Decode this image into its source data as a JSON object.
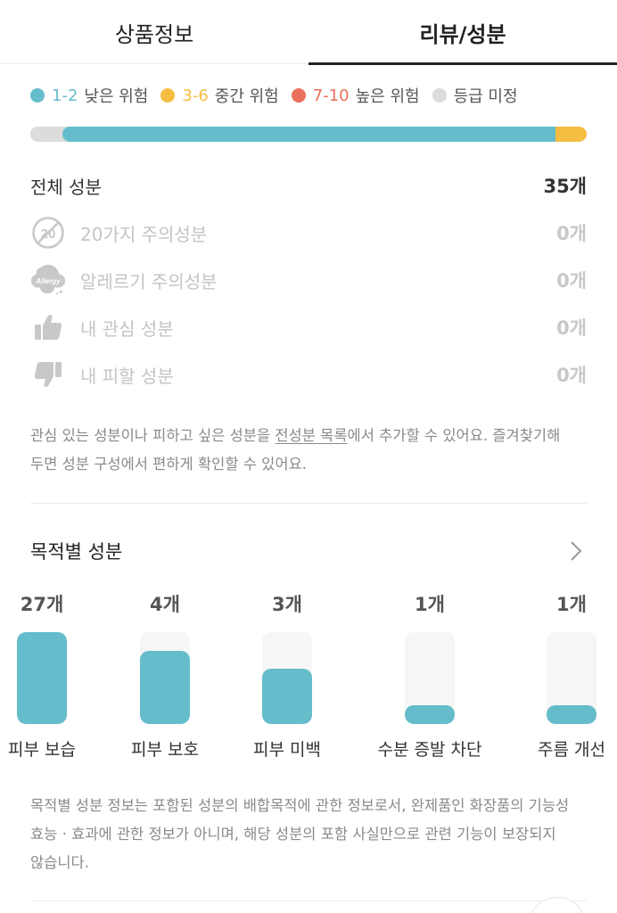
{
  "tabs": [
    {
      "label": "상품정보",
      "active": false
    },
    {
      "label": "리뷰/성분",
      "active": true
    }
  ],
  "legend": [
    {
      "range": "1-2",
      "text": "낮은 위험",
      "color": "#65bccb"
    },
    {
      "range": "3-6",
      "text": "중간 위험",
      "color": "#f5bd41"
    },
    {
      "range": "7-10",
      "text": "높은 위험",
      "color": "#e9705a"
    },
    {
      "range": "",
      "text": "등급 미정",
      "color": "#dcdcdc"
    }
  ],
  "risk_bar": {
    "segments": [
      {
        "level": "등급 미정",
        "fraction": 0.058,
        "color": "#dcdcdc"
      },
      {
        "level": "1-2",
        "fraction": 0.886,
        "color": "#65bccb"
      },
      {
        "level": "3-6",
        "fraction": 0.056,
        "color": "#f5bd41"
      }
    ]
  },
  "total": {
    "label": "전체 성분",
    "count": "35개"
  },
  "ingredient_rows": [
    {
      "icon": "twenty-caution-icon",
      "label": "20가지 주의성분",
      "count": "0개"
    },
    {
      "icon": "allergy-cloud-icon",
      "label": "알레르기 주의성분",
      "count": "0개"
    },
    {
      "icon": "thumbs-up-icon",
      "label": "내 관심 성분",
      "count": "0개"
    },
    {
      "icon": "thumbs-down-icon",
      "label": "내 피할 성분",
      "count": "0개"
    }
  ],
  "icon_text": {
    "twenty": "20",
    "allergy": "Allergy"
  },
  "note1": {
    "before": "관심 있는 성분이나 피하고 싶은 성분을 ",
    "link": "전성분 목록",
    "after": "에서 추가할 수 있어요. 즐겨찾기해 두면 성분 구성에서 편하게 확인할 수 있어요."
  },
  "purpose": {
    "title": "목적별 성분",
    "items": [
      {
        "count": "27개",
        "label": "피부 보습",
        "value": 27
      },
      {
        "count": "4개",
        "label": "피부 보호",
        "value": 4
      },
      {
        "count": "3개",
        "label": "피부 미백",
        "value": 3
      },
      {
        "count": "1개",
        "label": "수분 증발 차단",
        "value": 1
      },
      {
        "count": "1개",
        "label": "주름 개선",
        "value": 1
      }
    ],
    "fill_fractions": [
      1.0,
      0.8,
      0.6,
      0.2,
      0.2
    ]
  },
  "note2": "목적별 성분 정보는 포함된 성분의 배합목적에 관한 정보로서, 완제품인 화장품의 기능성 효능 · 효과에 관한 정보가 아니며, 해당 성분의 포함 사실만으로 관련 기능이 보장되지 않습니다."
}
